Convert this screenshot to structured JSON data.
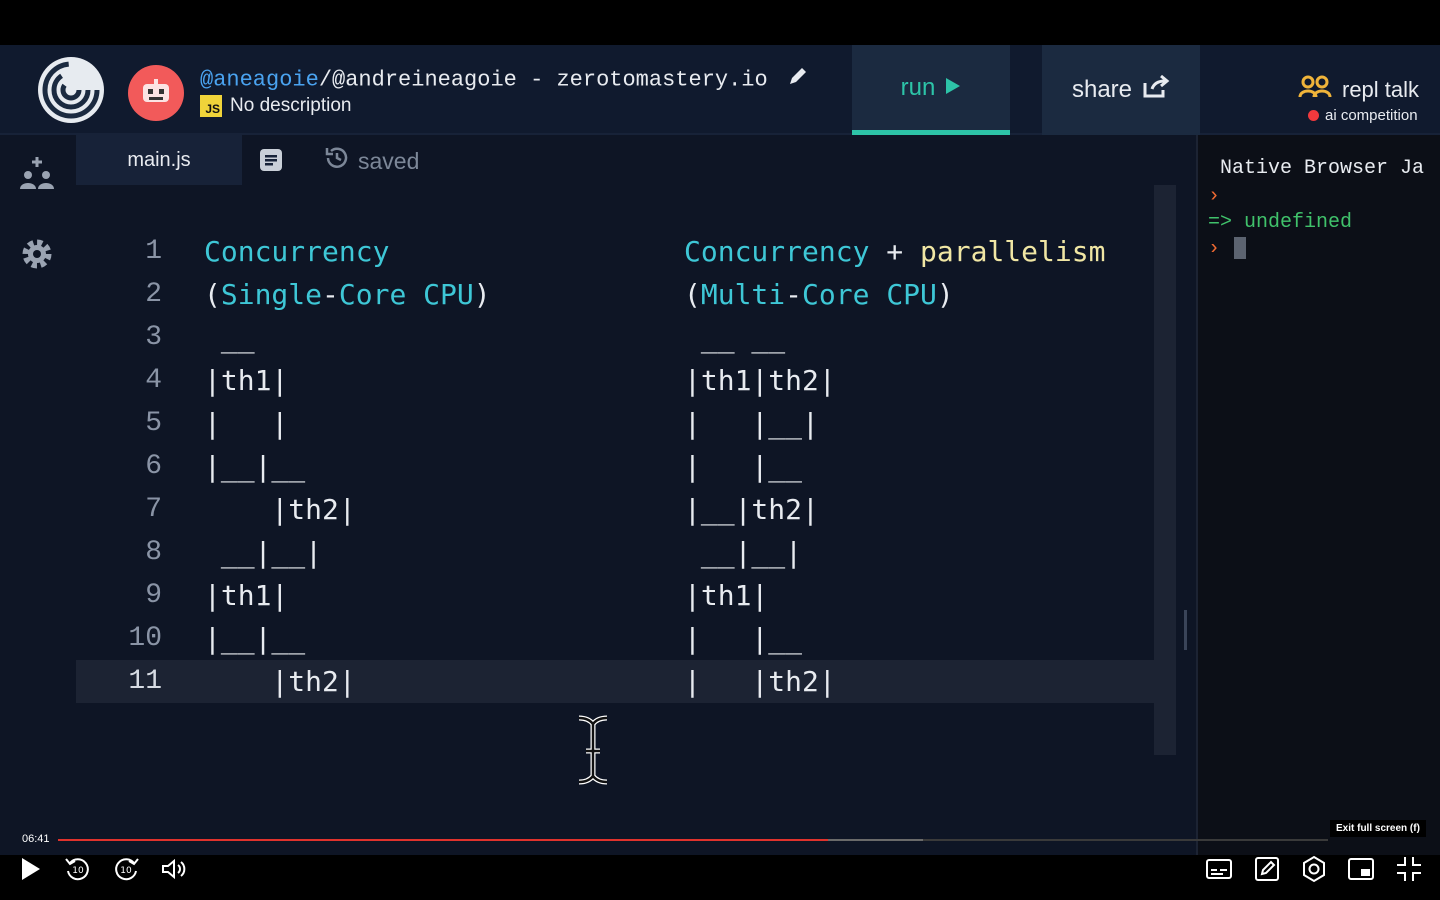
{
  "header": {
    "title_user": "@aneagoie",
    "title_rest": "/@andreineagoie - zerotomastery.io",
    "js_badge": "JS",
    "description": "No description",
    "run_label": "run",
    "share_label": "share",
    "repl_talk_label": "repl talk",
    "ai_competition_label": "ai competition"
  },
  "tabs": {
    "file_name": "main.js",
    "status": "saved"
  },
  "editor": {
    "lines": [
      {
        "n": "1",
        "a": "Concurrency",
        "b": "Concurrency + parallelism"
      },
      {
        "n": "2",
        "a": "(Single-Core CPU)",
        "b": "(Multi-Core CPU)"
      },
      {
        "n": "3",
        "a": " __",
        "b": " __ __"
      },
      {
        "n": "4",
        "a": "|th1|",
        "b": "|th1|th2|"
      },
      {
        "n": "5",
        "a": "|   |",
        "b": "|   |__|"
      },
      {
        "n": "6",
        "a": "|__|__",
        "b": "|   |__"
      },
      {
        "n": "7",
        "a": "    |th2|",
        "b": "|__|th2|"
      },
      {
        "n": "8",
        "a": " __|__|",
        "b": " __|__|"
      },
      {
        "n": "9",
        "a": "|th1|",
        "b": "|th1|"
      },
      {
        "n": "10",
        "a": "|__|__",
        "b": "|   |__"
      },
      {
        "n": "11",
        "a": "    |th2|",
        "b": "|   |th2|"
      }
    ],
    "active_line": 11
  },
  "console": {
    "title": "Native Browser Ja",
    "result_prefix": "=>",
    "result_value": "undefined",
    "prompt": "›"
  },
  "player": {
    "current_time": "06:41",
    "progress_fraction": 0.606,
    "buffered_fraction": 0.681,
    "tooltip": "Exit full screen (f)",
    "skip_seconds": "10"
  },
  "colors": {
    "accent_run": "#2dc4a8",
    "user_link": "#4aa3f0",
    "keyword": "#3ec7d6",
    "progress": "#e0322c"
  }
}
